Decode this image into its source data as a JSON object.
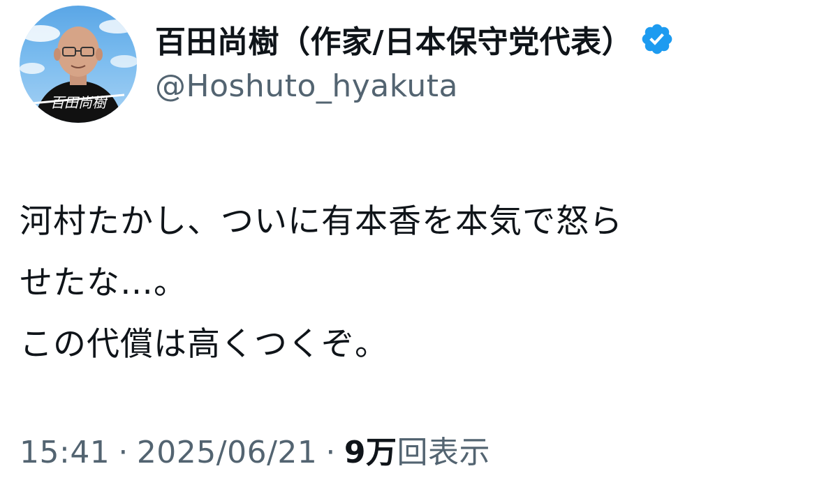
{
  "author": {
    "display_name": "百田尚樹（作家/日本保守党代表）",
    "handle": "@Hoshuto_hyakuta",
    "avatar_caption": "百田尚樹",
    "verified": true,
    "verified_color": "#1d9bf0"
  },
  "tweet": {
    "lines": [
      "河村たかし、ついに有本香を本気で怒ら",
      "せたな…。",
      "この代償は高くつくぞ。"
    ]
  },
  "meta": {
    "time": "15:41",
    "separator": "·",
    "date": "2025/06/21",
    "views_count": "9万",
    "views_label": "回表示"
  },
  "colors": {
    "text_primary": "#0f1419",
    "text_secondary": "#536471",
    "background": "#ffffff"
  }
}
